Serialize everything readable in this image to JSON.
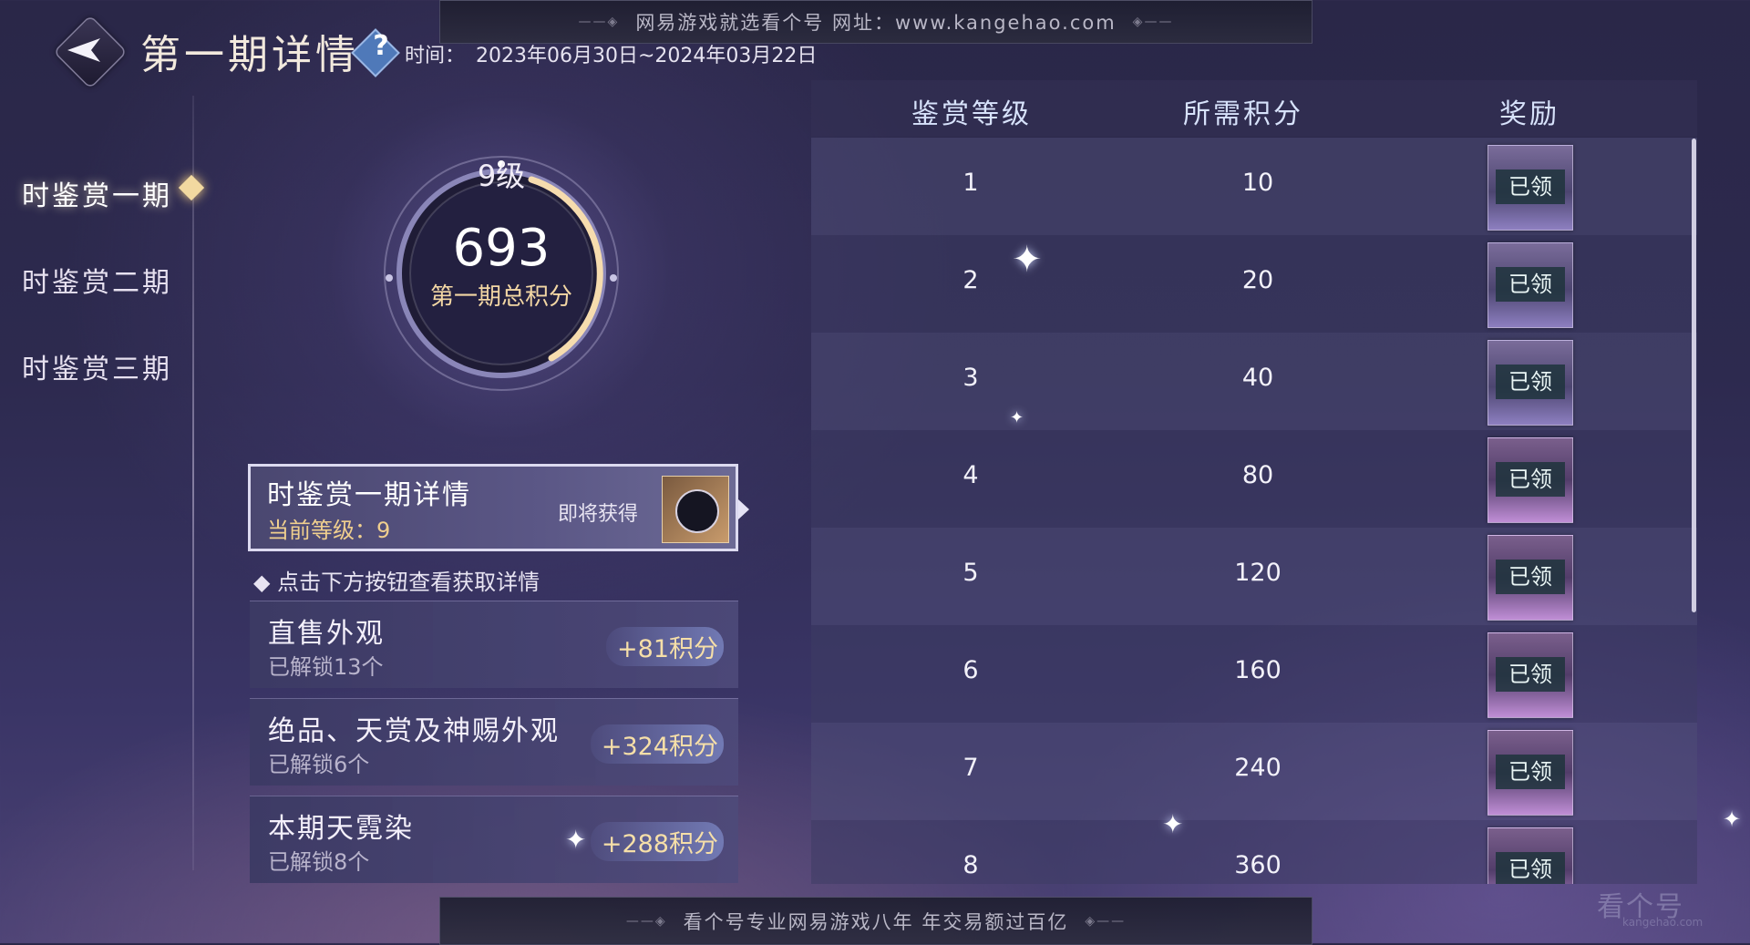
{
  "watermark": {
    "top": "网易游戏就选看个号   网址：www.kangehao.com",
    "bottom": "看个号专业网易游戏八年   年交易额过百亿"
  },
  "header": {
    "title": "第一期详情",
    "help_symbol": "?",
    "time_label": "时间：",
    "time_value": "2023年06月30日~2024年03月22日"
  },
  "sidebar": {
    "items": [
      {
        "label": "时鉴赏一期"
      },
      {
        "label": "时鉴赏二期"
      },
      {
        "label": "时鉴赏三期"
      }
    ],
    "active_index": 0
  },
  "medallion": {
    "level_text": "9级",
    "score": "693",
    "label": "第一期总积分"
  },
  "detail_card": {
    "title": "时鉴赏一期详情",
    "current_level": "当前等级：9",
    "soon_label": "即将获得"
  },
  "hint": "◆ 点击下方按钮查看获取详情",
  "categories": [
    {
      "name": "直售外观",
      "unlocked": "已解锁13个",
      "points": "+81积分"
    },
    {
      "name": "绝品、天赏及神赐外观",
      "unlocked": "已解锁6个",
      "points": "+324积分"
    },
    {
      "name": "本期天霓染",
      "unlocked": "已解锁8个",
      "points": "+288积分"
    }
  ],
  "table": {
    "headers": [
      "鉴赏等级",
      "所需积分",
      "奖励"
    ],
    "rows": [
      {
        "level": "1",
        "points": "10",
        "reward": "已领"
      },
      {
        "level": "2",
        "points": "20",
        "reward": "已领"
      },
      {
        "level": "3",
        "points": "40",
        "reward": "已领"
      },
      {
        "level": "4",
        "points": "80",
        "reward": "已领"
      },
      {
        "level": "5",
        "points": "120",
        "reward": "已领"
      },
      {
        "level": "6",
        "points": "160",
        "reward": "已领"
      },
      {
        "level": "7",
        "points": "240",
        "reward": "已领"
      },
      {
        "level": "8",
        "points": "360",
        "reward": "已领"
      }
    ]
  },
  "corner_logo": {
    "main": "看个号",
    "sub": "kangehao.com"
  },
  "colors": {
    "accent_gold": "#f0cf8e",
    "header_blue": "#d7e2fb",
    "background": "#2d2a4f"
  }
}
